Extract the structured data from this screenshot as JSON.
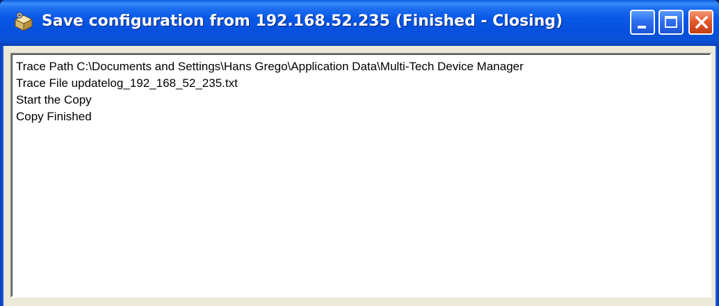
{
  "window": {
    "title": "Save configuration from 192.168.52.235 (Finished - Closing)",
    "icon": "gear-package-icon",
    "controls": {
      "minimize": "minimize-icon",
      "maximize": "maximize-icon",
      "close": "close-icon"
    }
  },
  "log": {
    "lines": [
      "Trace Path C:\\Documents and Settings\\Hans Grego\\Application Data\\Multi-Tech Device Manager",
      "Trace File updatelog_192_168_52_235.txt",
      "Start the Copy",
      "Copy Finished"
    ]
  },
  "colors": {
    "titlebar": "#0757e6",
    "frame_body": "#ece9d8",
    "close_button": "#e35a2c"
  }
}
